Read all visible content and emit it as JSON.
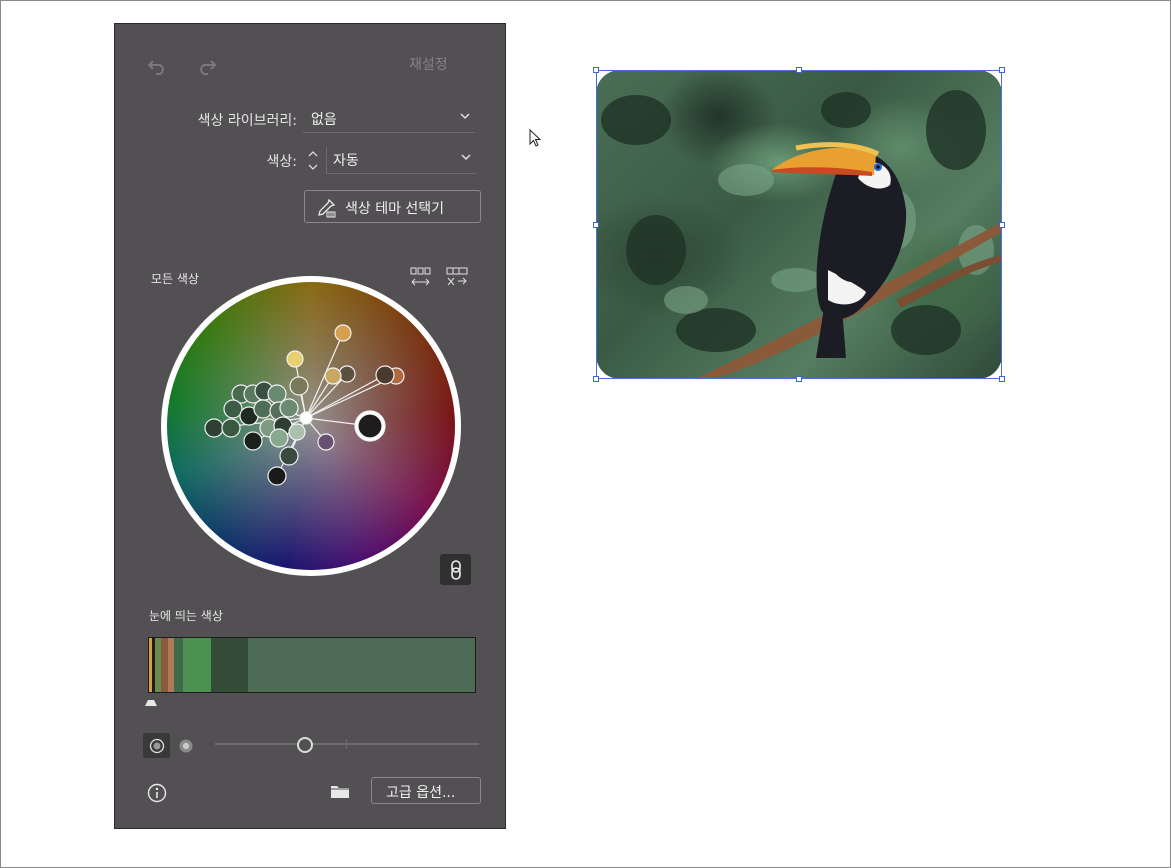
{
  "panel": {
    "reset_label": "재설정",
    "library_label": "색상 라이브러리:",
    "library_value": "없음",
    "colors_label": "색상:",
    "colors_value": "자동",
    "theme_picker_label": "색상 테마 선택기",
    "all_colors_label": "모든 색상",
    "prominent_label": "눈에 띄는 색상",
    "advanced_label": "고급 옵션..."
  },
  "prominent_colors": [
    {
      "color": "#d4a040",
      "weight": 1
    },
    {
      "color": "#1e1e1e",
      "weight": 1
    },
    {
      "color": "#6a8a50",
      "weight": 2
    },
    {
      "color": "#8a5a3a",
      "weight": 2
    },
    {
      "color": "#b07a5a",
      "weight": 2
    },
    {
      "color": "#3f6a4a",
      "weight": 3
    },
    {
      "color": "#4c9150",
      "weight": 9
    },
    {
      "color": "#334d38",
      "weight": 12
    },
    {
      "color": "#4e6b55",
      "weight": 73
    }
  ],
  "colors": {
    "panel_bg": "#535053",
    "selection": "#4a70e0"
  }
}
